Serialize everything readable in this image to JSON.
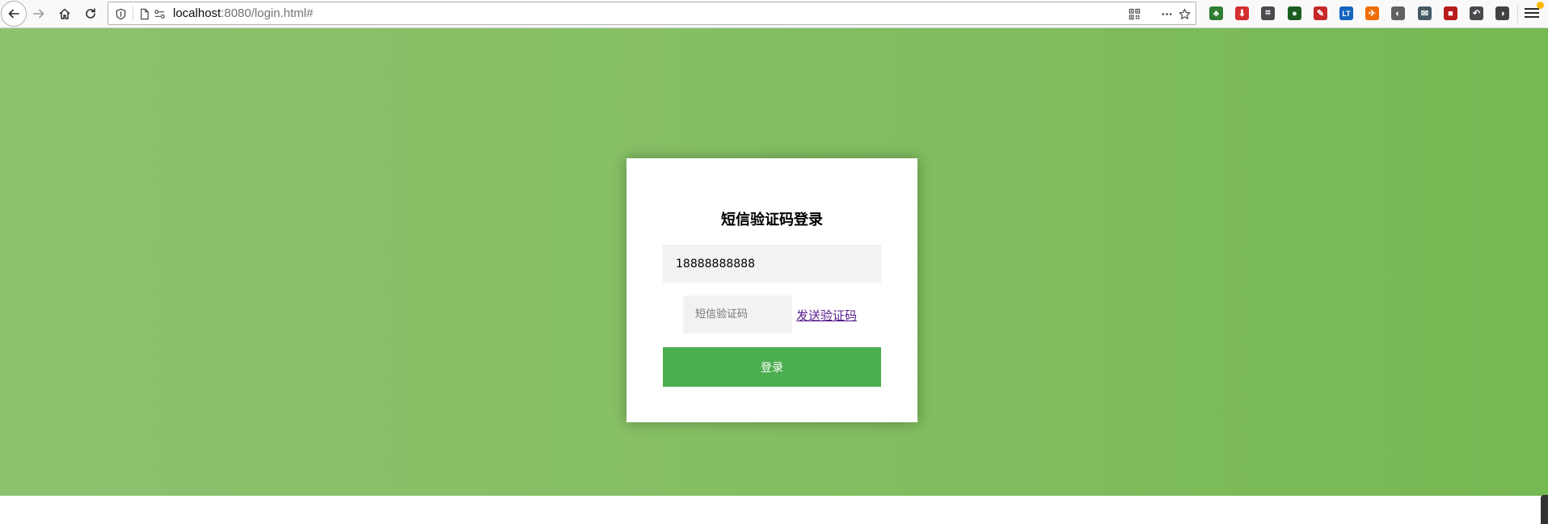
{
  "browser": {
    "url_host": "localhost",
    "url_path": ":8080/login.html#",
    "icons": [
      "back-icon",
      "forward-icon",
      "home-icon",
      "reload-icon",
      "shield-icon",
      "page-icon",
      "permissions-icon",
      "qr-code-icon",
      "more-icon",
      "bookmark-star-icon",
      "menu-icon"
    ],
    "extensions": [
      {
        "name": "ext-tree-icon",
        "color": "#2e7d32",
        "glyph": "♣"
      },
      {
        "name": "ext-download-icon",
        "color": "#d32f2f",
        "glyph": "⬇"
      },
      {
        "name": "ext-crop-icon",
        "color": "#4a4a4f",
        "glyph": "⌗"
      },
      {
        "name": "ext-color-wheel-icon",
        "color": "#1b5e20",
        "glyph": "●"
      },
      {
        "name": "ext-wand-icon",
        "color": "#c62828",
        "glyph": "✎"
      },
      {
        "name": "ext-lt-icon",
        "color": "#1565c0",
        "glyph": "LT"
      },
      {
        "name": "ext-shoe-icon",
        "color": "#ef6c00",
        "glyph": "✈"
      },
      {
        "name": "ext-bulb-icon",
        "color": "#616161",
        "glyph": "◐"
      },
      {
        "name": "ext-chat-icon",
        "color": "#455a64",
        "glyph": "✉"
      },
      {
        "name": "ext-red-square-icon",
        "color": "#b71c1c",
        "glyph": "■"
      },
      {
        "name": "ext-undo-icon",
        "color": "#4a4a4f",
        "glyph": "↶"
      },
      {
        "name": "ext-toggle-icon",
        "color": "#424242",
        "glyph": "◑"
      }
    ]
  },
  "login": {
    "title": "短信验证码登录",
    "phone_value": "18888888888",
    "code_placeholder": "短信验证码",
    "send_code_label": "发送验证码",
    "submit_label": "登录"
  },
  "colors": {
    "background_start": "#8dc26f",
    "background_end": "#76b852",
    "button": "#4caf50",
    "link": "#551a8b"
  }
}
